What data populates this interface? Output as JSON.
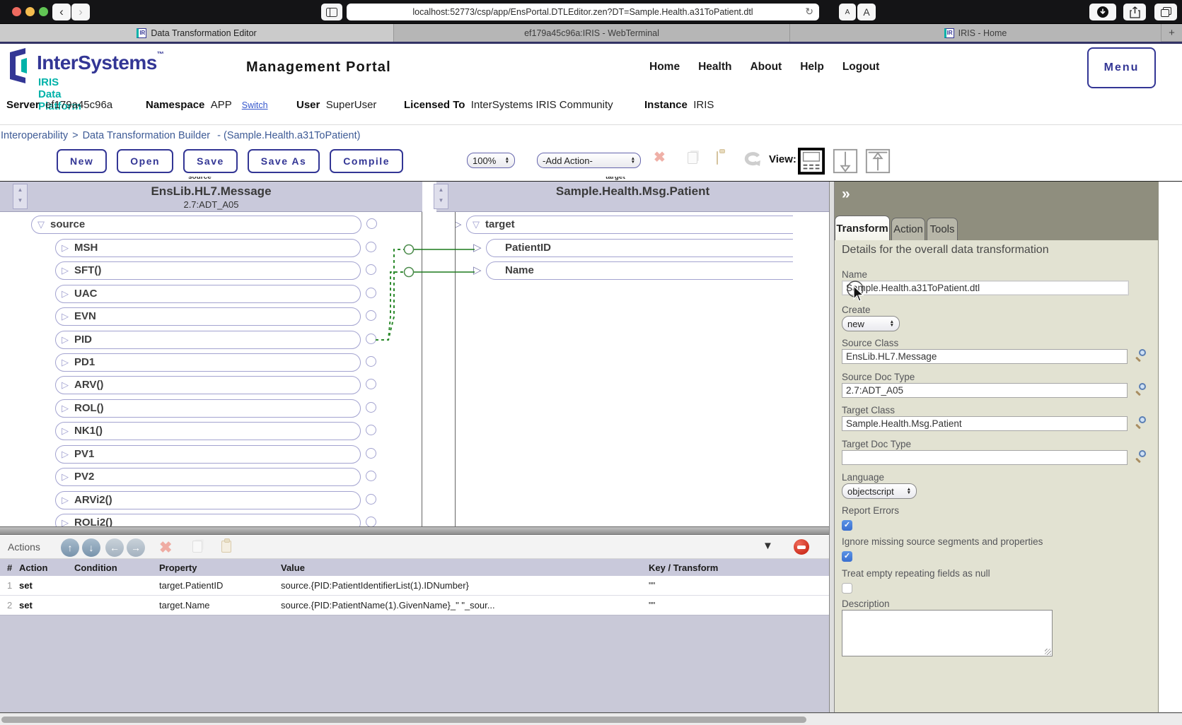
{
  "colors": {
    "accent_navy": "#333695",
    "brand_teal": "#00b2a9",
    "band_lavender": "#c9c9db",
    "panel_olive": "#8f8e7e",
    "panel_bg": "#e2e2d2",
    "connector_green": "#2e8b2e",
    "checkbox_blue": "#3a76d8",
    "breadcrumb_blue": "#3e5b96"
  },
  "browser": {
    "url": "localhost:52773/csp/app/EnsPortal.DTLEditor.zen?DT=Sample.Health.a31ToPatient.dtl",
    "reload_icon": "↻",
    "font_small": "A",
    "font_large": "A",
    "tabs": [
      {
        "label": "Data Transformation Editor",
        "favicon": "IR"
      },
      {
        "label": "ef179a45c96a:IRIS - WebTerminal",
        "favicon": ""
      },
      {
        "label": "IRIS - Home",
        "favicon": "IR"
      }
    ],
    "new_tab": "+"
  },
  "header": {
    "brand": "InterSystems",
    "brand_tm": "™",
    "brand_sub": "IRIS Data Platform",
    "title": "Management Portal",
    "nav": [
      "Home",
      "Health",
      "About",
      "Help",
      "Logout"
    ],
    "menu_button": "Menu",
    "server_label": "Server",
    "server_value": "ef179a45c96a",
    "namespace_label": "Namespace",
    "namespace_value": "APP",
    "switch_link": "Switch",
    "user_label": "User",
    "user_value": "SuperUser",
    "licensed_label": "Licensed To",
    "licensed_value": "InterSystems IRIS Community",
    "instance_label": "Instance",
    "instance_value": "IRIS"
  },
  "breadcrumb": {
    "root": "Interoperability",
    "sep": ">",
    "page": "Data Transformation Builder",
    "detail": "- (Sample.Health.a31ToPatient)"
  },
  "toolbar": {
    "buttons": [
      "New",
      "Open",
      "Save",
      "Save As",
      "Compile"
    ],
    "zoom_value": "100%",
    "add_action_value": "-Add Action-",
    "view_label": "View:"
  },
  "diagram": {
    "source_mini": "source",
    "target_mini": "target",
    "source_class": "EnsLib.HL7.Message",
    "source_doc_type": "2.7:ADT_A05",
    "target_class": "Sample.Health.Msg.Patient",
    "source_root": "source",
    "source_children": [
      "MSH",
      "SFT()",
      "UAC",
      "EVN",
      "PID",
      "PD1",
      "ARV()",
      "ROL()",
      "NK1()",
      "PV1",
      "PV2",
      "ARVi2()",
      "ROLi2()"
    ],
    "target_root": "target",
    "target_children": [
      "PatientID",
      "Name"
    ]
  },
  "actions": {
    "title": "Actions",
    "columns": [
      "#",
      "Action",
      "Condition",
      "Property",
      "Value",
      "Key / Transform"
    ],
    "rows": [
      {
        "num": "1",
        "action": "set",
        "condition": "",
        "property": "target.PatientID",
        "value": "source.{PID:PatientIdentifierList(1).IDNumber}",
        "key": "\"\""
      },
      {
        "num": "2",
        "action": "set",
        "condition": "",
        "property": "target.Name",
        "value": "source.{PID:PatientName(1).GivenName}_\" \"_sour...",
        "key": "\"\""
      }
    ]
  },
  "panel": {
    "collapse_icon": "»",
    "tabs": [
      "Transform",
      "Action",
      "Tools"
    ],
    "heading": "Details for the overall data transformation",
    "name_label": "Name",
    "name_value": "Sample.Health.a31ToPatient.dtl",
    "create_label": "Create",
    "create_value": "new",
    "source_class_label": "Source Class",
    "source_class_value": "EnsLib.HL7.Message",
    "source_doc_label": "Source Doc Type",
    "source_doc_value": "2.7:ADT_A05",
    "target_class_label": "Target Class",
    "target_class_value": "Sample.Health.Msg.Patient",
    "target_doc_label": "Target Doc Type",
    "target_doc_value": "",
    "language_label": "Language",
    "language_value": "objectscript",
    "report_errors_label": "Report Errors",
    "ignore_label": "Ignore missing source segments and properties",
    "treat_label": "Treat empty repeating fields as null",
    "description_label": "Description"
  }
}
